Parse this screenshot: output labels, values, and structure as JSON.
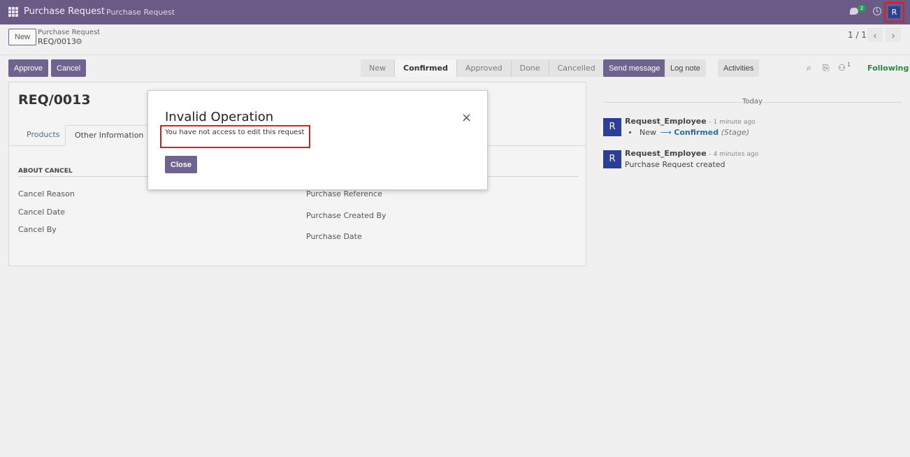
{
  "navbar": {
    "app_name": "Purchase Request",
    "menu_item": "Purchase Request",
    "message_count": "2",
    "avatar_initial": "R"
  },
  "control_panel": {
    "new_label": "New",
    "breadcrumb_parent": "Purchase Request",
    "breadcrumb_current": "REQ/0013",
    "pager": "1 / 1",
    "prev_label": "‹",
    "next_label": "›"
  },
  "statusbar": {
    "approve_label": "Approve",
    "cancel_label": "Cancel",
    "stages": [
      "New",
      "Confirmed",
      "Approved",
      "Done",
      "Cancelled"
    ],
    "active_stage": "Confirmed"
  },
  "form": {
    "title": "REQ/0013",
    "tabs": [
      "Products",
      "Other Information"
    ],
    "active_tab": "Other Information",
    "left_group": {
      "title": "ABOUT CANCEL",
      "fields": [
        "Cancel Reason",
        "Cancel Date",
        "Cancel By"
      ]
    },
    "right_group": {
      "fields": [
        "Purchase Reference",
        "Purchase Created By",
        "Purchase Date"
      ]
    }
  },
  "chatter": {
    "send_message_label": "Send message",
    "log_note_label": "Log note",
    "activities_label": "Activities",
    "followers_count": "1",
    "following_label": "Following",
    "date_separator": "Today",
    "messages": [
      {
        "avatar": "R",
        "author": "Request_Employee",
        "time": "- 1 minute ago",
        "old_value": "New",
        "arrow": "⟶",
        "new_value": "Confirmed",
        "field": "(Stage)"
      },
      {
        "avatar": "R",
        "author": "Request_Employee",
        "time": "- 4 minutes ago",
        "body": "Purchase Request created"
      }
    ]
  },
  "modal": {
    "title": "Invalid Operation",
    "message": "You have not access to edit this request",
    "close_button": "Close",
    "close_icon": "×"
  },
  "colors": {
    "navbar": "#6a5a86",
    "primary": "#6f6490",
    "highlight": "#d81f1f",
    "following": "#2a8a45",
    "avatar": "#2c3f97"
  }
}
